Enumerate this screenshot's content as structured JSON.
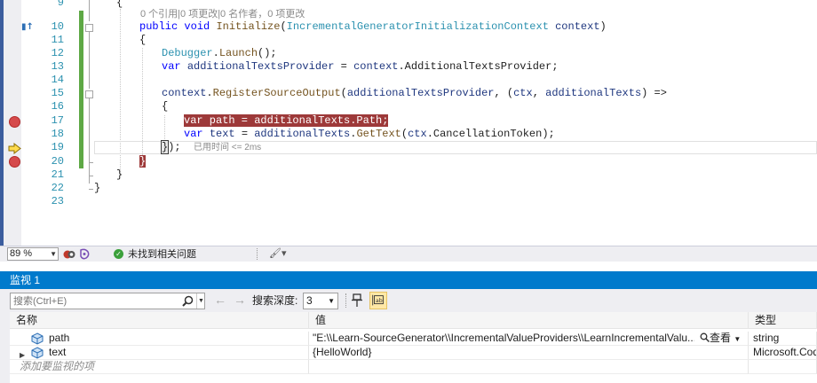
{
  "editor": {
    "lines": [
      {
        "num": "9"
      },
      {
        "num": "10"
      },
      {
        "num": "11"
      },
      {
        "num": "12"
      },
      {
        "num": "13"
      },
      {
        "num": "14"
      },
      {
        "num": "15"
      },
      {
        "num": "16"
      },
      {
        "num": "17"
      },
      {
        "num": "18"
      },
      {
        "num": "19"
      },
      {
        "num": "20"
      },
      {
        "num": "21"
      },
      {
        "num": "22"
      },
      {
        "num": "23"
      }
    ],
    "codelens": "0 个引用|0 项更改|0 名作者，0 项更改",
    "code": {
      "l9": "{",
      "l10_kw1": "public",
      "l10_kw2": "void",
      "l10_m": "Initialize",
      "l10_p1": "(",
      "l10_ty": "IncrementalGeneratorInitializationContext",
      "l10_sp": " ",
      "l10_id": "context",
      "l10_p2": ")",
      "l11": "{",
      "l12_ty": "Debugger",
      "l12_dot": ".",
      "l12_m": "Launch",
      "l12_end": "();",
      "l13_kw": "var",
      "l13_id": "additionalTextsProvider",
      "l13_eq": " = ",
      "l13_id2": "context",
      "l13_rest": ".AdditionalTextsProvider;",
      "l15_id": "context",
      "l15_dot": ".",
      "l15_m": "RegisterSourceOutput",
      "l15_p1": "(",
      "l15_id2": "additionalTextsProvider",
      "l15_c": ", (",
      "l15_id3": "ctx",
      "l15_c2": ", ",
      "l15_id4": "additionalTexts",
      "l15_end": ") =>",
      "l16": "{",
      "l17": "var path = additionalTexts.Path;",
      "l18_kw": "var",
      "l18_id": "text",
      "l18_eq": " = ",
      "l18_id2": "additionalTexts",
      "l18_dot": ".",
      "l18_m": "GetText",
      "l18_p": "(",
      "l18_id3": "ctx",
      "l18_rest": ".CancellationToken);",
      "l19_brace": "}",
      "l19_rest": ");",
      "l19_tip": "已用时间 <= 2ms",
      "l20": "}",
      "l21": "}",
      "l22": "}"
    }
  },
  "status_bar": {
    "zoom": "89 %",
    "issues": "未找到相关问题"
  },
  "watch": {
    "title": "监视 1",
    "search_placeholder": "搜索(Ctrl+E)",
    "depth_label": "搜索深度:",
    "depth_value": "3",
    "columns": {
      "name": "名称",
      "value": "值",
      "type": "类型"
    },
    "rows": [
      {
        "name": "path",
        "value": "\"E:\\\\Learn-SourceGenerator\\\\IncrementalValueProviders\\\\LearnIncrementalValu...",
        "view": "查看",
        "type": "string"
      },
      {
        "name": "text",
        "value": "{HelloWorld}",
        "type": "Microsoft.Code"
      }
    ],
    "add_hint": "添加要监视的项"
  },
  "colors": {
    "accent": "#007acc",
    "breakpoint": "#d54a4c",
    "change_bar": "#5ea845"
  }
}
